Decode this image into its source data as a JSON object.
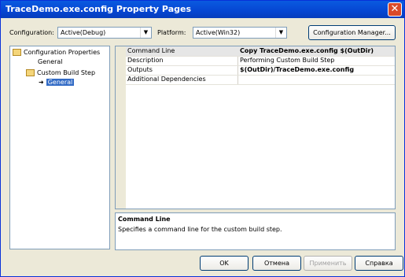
{
  "window": {
    "title": "TraceDemo.exe.config Property Pages"
  },
  "toolbar": {
    "configuration_label": "Configuration:",
    "configuration_value": "Active(Debug)",
    "platform_label": "Platform:",
    "platform_value": "Active(Win32)",
    "config_manager_label": "Configuration Manager..."
  },
  "tree": {
    "root": "Configuration Properties",
    "general": "General",
    "custom_build_step": "Custom Build Step",
    "custom_general": "General"
  },
  "properties": [
    {
      "name": "Command Line",
      "value": "Copy TraceDemo.exe.config $(OutDir)"
    },
    {
      "name": "Description",
      "value": "Performing Custom Build Step"
    },
    {
      "name": "Outputs",
      "value": "$(OutDir)/TraceDemo.exe.config"
    },
    {
      "name": "Additional Dependencies",
      "value": ""
    }
  ],
  "description": {
    "title": "Command Line",
    "text": "Specifies a command line for the custom build step."
  },
  "buttons": {
    "ok": "OK",
    "cancel": "Отмена",
    "apply": "Применить",
    "help": "Справка"
  }
}
